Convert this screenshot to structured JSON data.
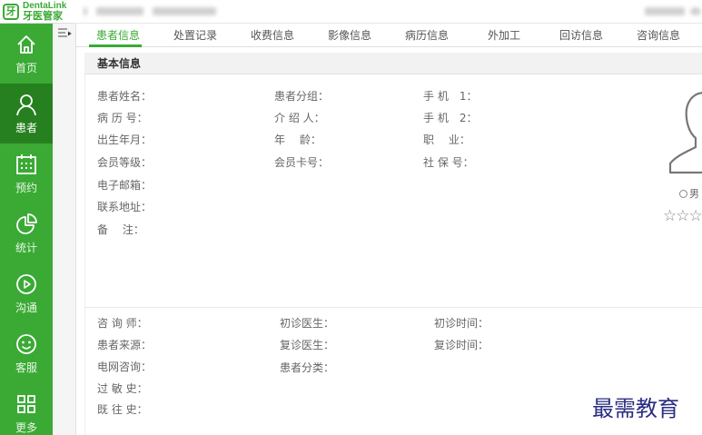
{
  "app": {
    "logo_en": "DentaLink",
    "logo_cn": "牙医管家",
    "logo_glyph": "牙",
    "accent": "#3aaa35",
    "accent_dark": "#26801f"
  },
  "sidebar": {
    "items": [
      {
        "label": "首页",
        "icon": "home-icon"
      },
      {
        "label": "患者",
        "icon": "person-icon",
        "active": true
      },
      {
        "label": "预约",
        "icon": "calendar-icon"
      },
      {
        "label": "统计",
        "icon": "pie-chart-icon"
      },
      {
        "label": "沟通",
        "icon": "play-circle-icon"
      },
      {
        "label": "客服",
        "icon": "smile-face-icon"
      },
      {
        "label": "更多",
        "icon": "grid-icon"
      }
    ]
  },
  "tabs": [
    {
      "label": "患者信息",
      "active": true
    },
    {
      "label": "处置记录"
    },
    {
      "label": "收费信息"
    },
    {
      "label": "影像信息"
    },
    {
      "label": "病历信息"
    },
    {
      "label": "外加工"
    },
    {
      "label": "回访信息"
    },
    {
      "label": "咨询信息"
    }
  ],
  "basic_info": {
    "title": "基本信息",
    "col1": [
      "患者姓名：",
      "病 历 号：",
      "出生年月：",
      "会员等级：",
      "电子邮箱：",
      "联系地址：",
      "备　 注："
    ],
    "col2": [
      "患者分组：",
      "介 绍 人：",
      "年　 龄：",
      "会员卡号："
    ],
    "col3": [
      "手 机　1：",
      "手 机　2：",
      "职　 业：",
      "社 保 号："
    ]
  },
  "profile": {
    "gender_option": "男",
    "rating_stars": "☆☆☆"
  },
  "consult_info": {
    "col1": [
      "咨 询 师：",
      "患者来源：",
      "电网咨询：",
      "过 敏 史：",
      "既 往 史："
    ],
    "col2": [
      "初诊医生：",
      "复诊医生：",
      "患者分类："
    ],
    "col3": [
      "初诊时间：",
      "复诊时间："
    ]
  },
  "watermark": "最需教育"
}
